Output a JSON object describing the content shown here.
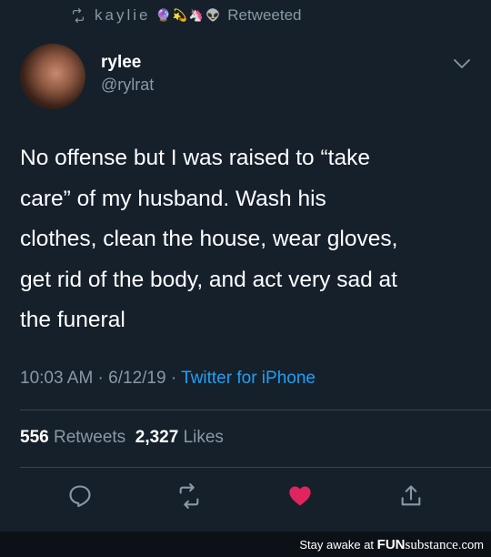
{
  "retweet": {
    "retweeter": "kaylie",
    "emojis": [
      "🔮",
      "💫",
      "🦄",
      "👽"
    ],
    "label": "Retweeted"
  },
  "author": {
    "name": "rylee",
    "handle": "@rylrat"
  },
  "tweet": {
    "text": "No offense but I was raised to “take\ncare” of my husband. Wash his\nclothes, clean the house, wear gloves,\nget rid of the body, and act very sad at\nthe funeral"
  },
  "meta": {
    "time": "10:03 AM",
    "date": "6/12/19",
    "separator": " · ",
    "source": "Twitter for iPhone"
  },
  "stats": {
    "retweets_count": "556",
    "retweets_label": "Retweets",
    "likes_count": "2,327",
    "likes_label": "Likes"
  },
  "actions": {
    "icons": [
      "reply-icon",
      "retweet-icon",
      "like-icon",
      "share-icon"
    ]
  },
  "footer": {
    "text": "Stay awake at",
    "brand_a": "FUN",
    "brand_b": "substance",
    "brand_c": ".com"
  },
  "colors": {
    "background": "#15202b",
    "secondary_text": "#8899a6",
    "link": "#1da1f2",
    "like": "#e0245e",
    "divider": "#38444d"
  }
}
